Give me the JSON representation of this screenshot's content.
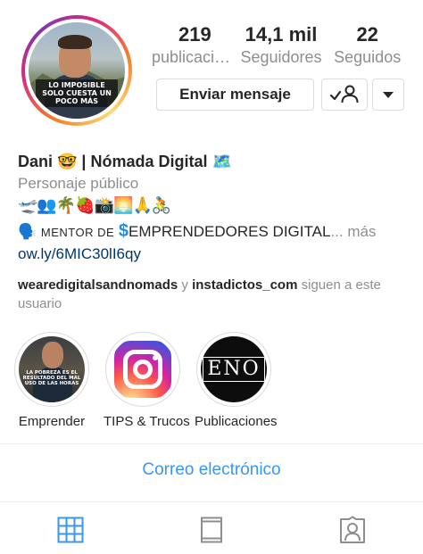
{
  "profile": {
    "avatar_caption": "LO IMPOSIBLE SOLO CUESTA UN POCO MÁS",
    "stats": [
      {
        "value": "219",
        "label": "publicaciones"
      },
      {
        "value": "14,1 mil",
        "label": "Seguidores"
      },
      {
        "value": "22",
        "label": "Seguidos"
      }
    ],
    "message_button": "Enviar mensaje",
    "follow_icon": "following-check-person-icon",
    "more_icon": "chevron-down-icon"
  },
  "bio": {
    "name": "Dani 🤓 | Nómada Digital 🗺️",
    "category": "Personaje público",
    "emojis": "🛫👥🌴🍓📸🌅🙏🚴",
    "mentor_emoji": "🗣️",
    "mentor_prefix": "MENTOR DE",
    "mentor_dollar": "$",
    "mentor_text": "EMPRENDEDORES DIGITAL",
    "mentor_more": "... más",
    "link": "ow.ly/6MIC30lI6qy",
    "followed_by_1": "wearedigitalsandnomads",
    "followed_and": " y ",
    "followed_by_2": "instadictos_com",
    "followed_suffix": " siguen a este usuario"
  },
  "highlights": [
    {
      "label": "Emprender",
      "image_text": "LA POBREZA ES EL RESULTADO DEL MAL USO DE LAS HORAS"
    },
    {
      "label": "TIPS & Trucos"
    },
    {
      "label": "Publicaciones",
      "image_text": "ENO"
    }
  ],
  "contact": {
    "email_button": "Correo electrónico"
  },
  "tabs": [
    {
      "name": "grid-icon",
      "active": true
    },
    {
      "name": "feed-icon",
      "active": false
    },
    {
      "name": "tagged-icon",
      "active": false
    }
  ],
  "colors": {
    "accent": "#3897f0",
    "link": "#00376b",
    "secondary_text": "#8e8e8e",
    "active_tab": "#3897f0"
  }
}
